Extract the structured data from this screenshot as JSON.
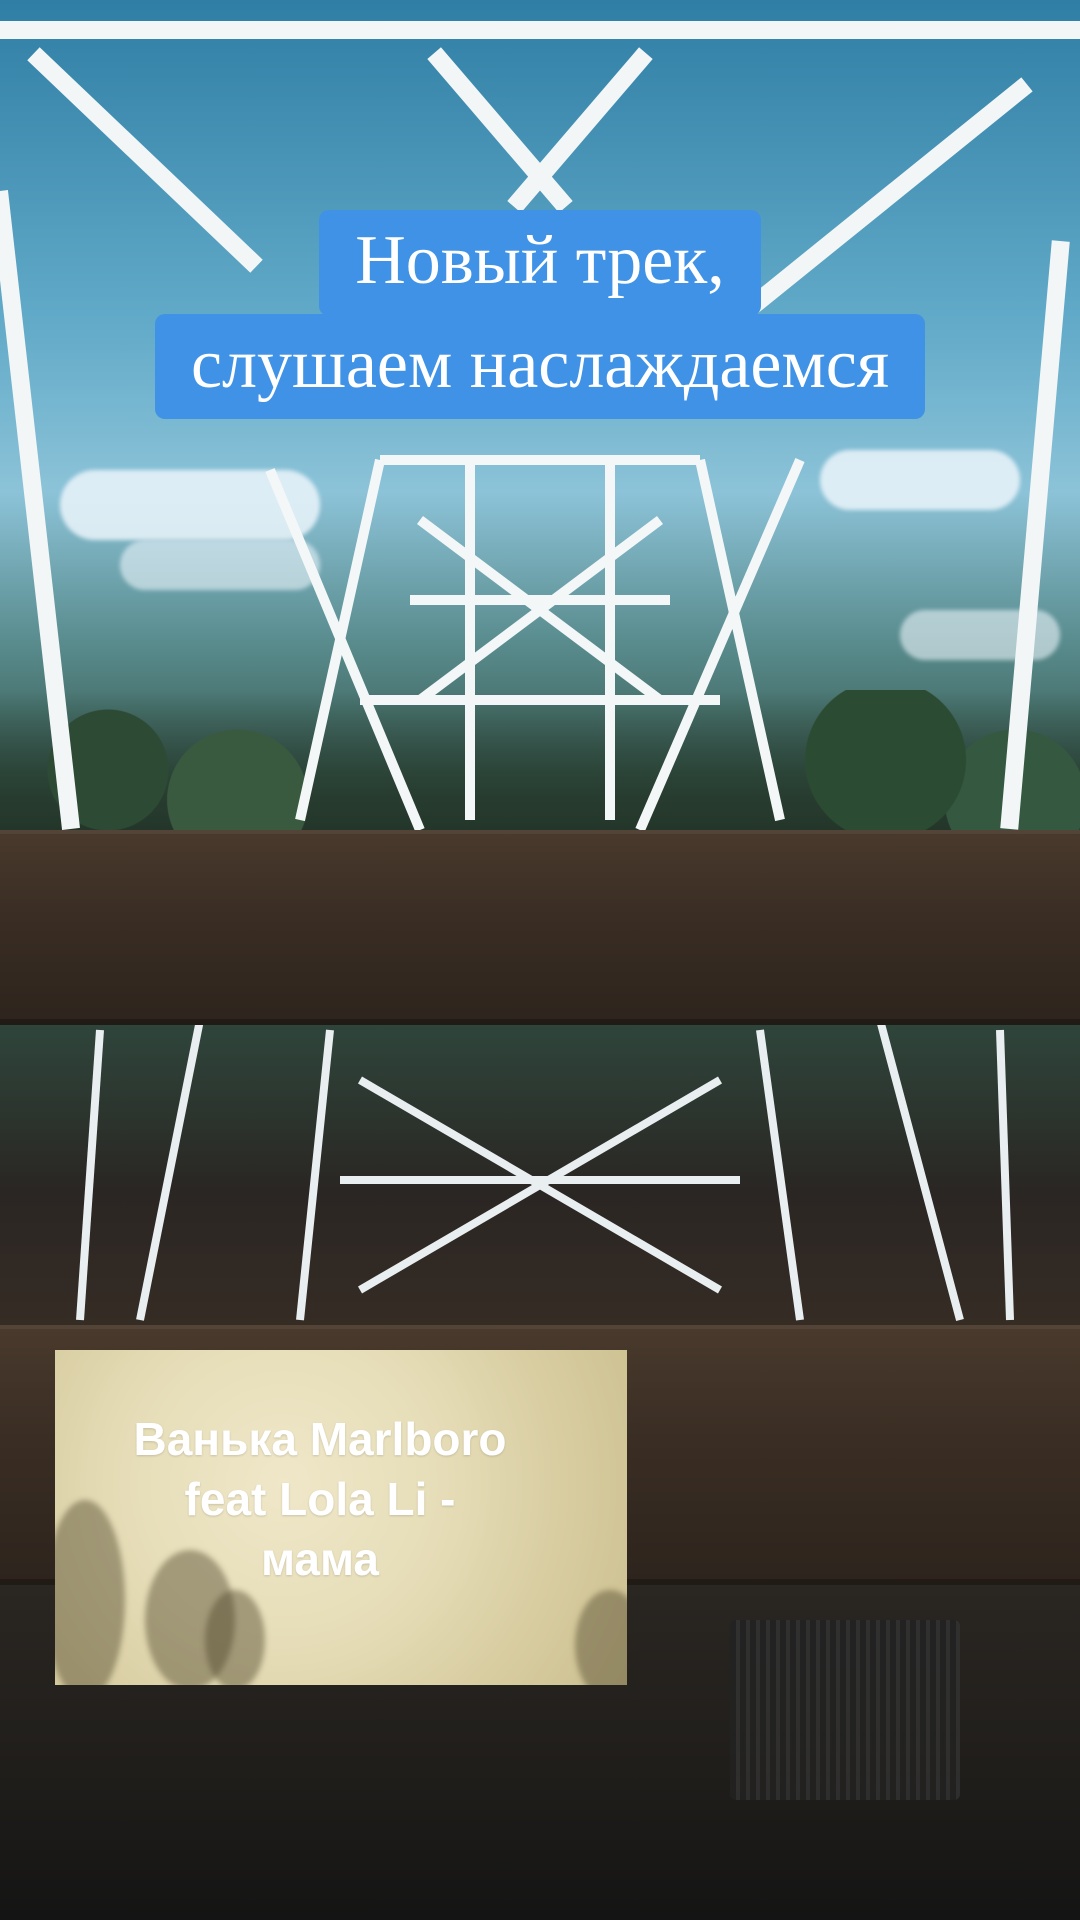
{
  "caption": {
    "line1": "Новый трек,",
    "line2": "слушаем наслаждаемся",
    "background": "#3f92e6"
  },
  "track": {
    "lines": [
      "Ванька Marlboro",
      "feat Lola Li -",
      "мама"
    ]
  }
}
